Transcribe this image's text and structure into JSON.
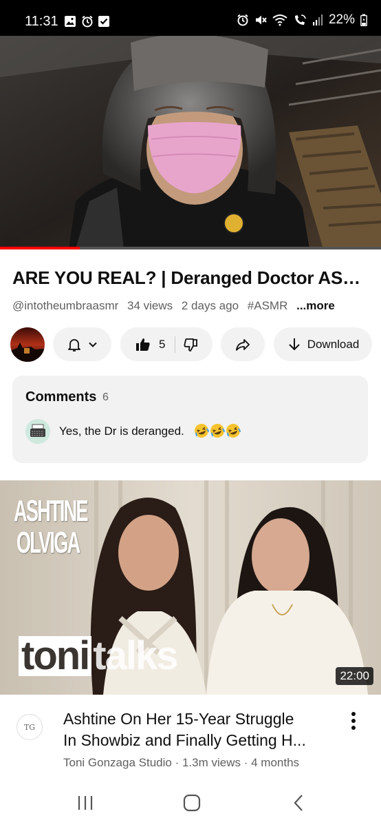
{
  "status_bar": {
    "time": "11:31",
    "battery": "22%",
    "left_icons": [
      "gallery-icon",
      "alarm-icon",
      "check-box-icon"
    ],
    "right_icons": [
      "alarm-icon",
      "mute-icon",
      "wifi-icon",
      "wifi-calling-icon",
      "signal-icon",
      "battery-icon"
    ]
  },
  "player": {
    "progress": 0.21,
    "accent": "#ff0000"
  },
  "video": {
    "title": "ARE YOU REAL? | Deranged Doctor ASMR",
    "handle": "@intotheumbraasmr",
    "views": "34 views",
    "age": "2 days ago",
    "hashtag": "#ASMR",
    "more": "...more"
  },
  "actions": {
    "like_count": "5",
    "download_label": "Download"
  },
  "comments": {
    "title": "Comments",
    "count": "6",
    "top_comment": "Yes, the Dr is deranged.",
    "emoji": [
      "rofl",
      "rofl",
      "rofl"
    ]
  },
  "next_video": {
    "thumbnail_text_1": "ASHTINE OLVIGA",
    "thumbnail_text_toni": "toni",
    "thumbnail_text_talks": "talks",
    "duration": "22:00",
    "title_line_1": "Ashtine On Her 15-Year Struggle",
    "title_line_2": "In Showbiz and Finally Getting H...",
    "channel": "Toni Gonzaga Studio",
    "views": "1.3m views",
    "age": "4 months",
    "channel_avatar_text": "TG"
  },
  "nav_bar": {
    "buttons": [
      "recents-icon",
      "home-icon",
      "back-icon"
    ]
  }
}
